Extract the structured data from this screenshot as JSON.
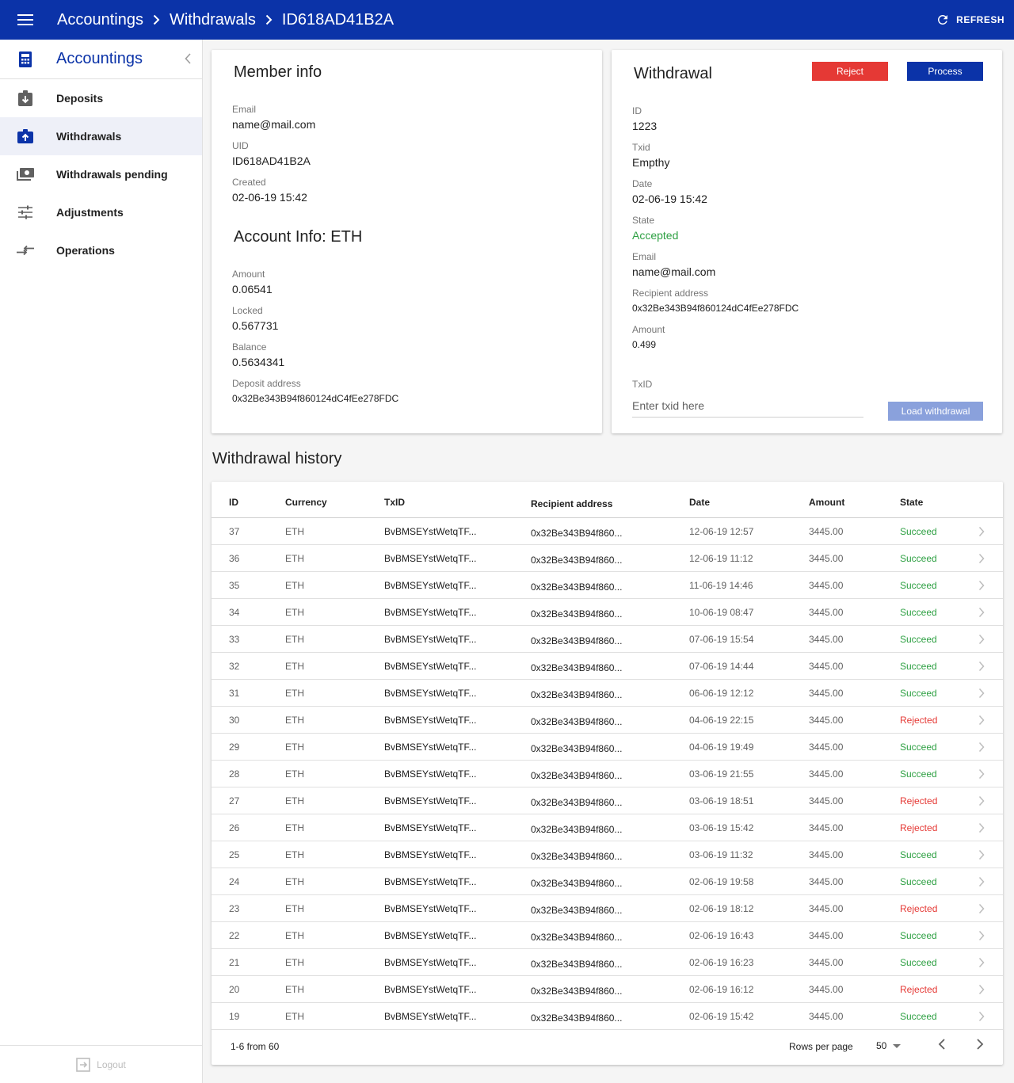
{
  "header": {
    "breadcrumb": [
      "Accountings",
      "Withdrawals",
      "ID618AD41B2A"
    ],
    "refresh_label": "REFRESH"
  },
  "sidebar": {
    "title": "Accountings",
    "items": [
      {
        "label": "Deposits",
        "icon": "deposit-icon"
      },
      {
        "label": "Withdrawals",
        "icon": "withdraw-icon"
      },
      {
        "label": "Withdrawals pending",
        "icon": "cash-icon"
      },
      {
        "label": "Adjustments",
        "icon": "tune-icon"
      },
      {
        "label": "Operations",
        "icon": "compare-arrows-icon"
      }
    ],
    "logout_label": "Logout"
  },
  "member_info": {
    "title": "Member info",
    "email_label": "Email",
    "email": "name@mail.com",
    "uid_label": "UID",
    "uid": "ID618AD41B2A",
    "created_label": "Created",
    "created": "02-06-19 15:42"
  },
  "account_info": {
    "title": "Account Info: ETH",
    "amount_label": "Amount",
    "amount": "0.06541",
    "locked_label": "Locked",
    "locked": "0.567731",
    "balance_label": "Balance",
    "balance": "0.5634341",
    "deposit_address_label": "Deposit address",
    "deposit_address": "0x32Be343B94f860124dC4fEe278FDC"
  },
  "withdrawal": {
    "title": "Withdrawal",
    "reject_label": "Reject",
    "process_label": "Process",
    "id_label": "ID",
    "id": "1223",
    "txid_label": "Txid",
    "txid": "Empthy",
    "date_label": "Date",
    "date": "02-06-19 15:42",
    "state_label": "State",
    "state": "Accepted",
    "email_label": "Email",
    "email": "name@mail.com",
    "recipient_label": "Recipient address",
    "recipient": "0x32Be343B94f860124dC4fEe278FDC",
    "amount_label": "Amount",
    "amount": "0.499",
    "txid_input_label": "TxID",
    "txid_input_placeholder": "Enter txid here",
    "load_label": "Load withdrawal"
  },
  "history": {
    "title": "Withdrawal history",
    "columns": [
      "ID",
      "Currency",
      "TxID",
      "Recipient address",
      "Date",
      "Amount",
      "State"
    ],
    "rows": [
      {
        "id": "37",
        "currency": "ETH",
        "txid": "BvBMSEYstWetqTF...",
        "address": "0x32Be343B94f860...",
        "date": "12-06-19 12:57",
        "amount": "3445.00",
        "state": "Succeed"
      },
      {
        "id": "36",
        "currency": "ETH",
        "txid": "BvBMSEYstWetqTF...",
        "address": "0x32Be343B94f860...",
        "date": "12-06-19 11:12",
        "amount": "3445.00",
        "state": "Succeed"
      },
      {
        "id": "35",
        "currency": "ETH",
        "txid": "BvBMSEYstWetqTF...",
        "address": "0x32Be343B94f860...",
        "date": "11-06-19 14:46",
        "amount": "3445.00",
        "state": "Succeed"
      },
      {
        "id": "34",
        "currency": "ETH",
        "txid": "BvBMSEYstWetqTF...",
        "address": "0x32Be343B94f860...",
        "date": "10-06-19 08:47",
        "amount": "3445.00",
        "state": "Succeed"
      },
      {
        "id": "33",
        "currency": "ETH",
        "txid": "BvBMSEYstWetqTF...",
        "address": "0x32Be343B94f860...",
        "date": "07-06-19 15:54",
        "amount": "3445.00",
        "state": "Succeed"
      },
      {
        "id": "32",
        "currency": "ETH",
        "txid": "BvBMSEYstWetqTF...",
        "address": "0x32Be343B94f860...",
        "date": "07-06-19 14:44",
        "amount": "3445.00",
        "state": "Succeed"
      },
      {
        "id": "31",
        "currency": "ETH",
        "txid": "BvBMSEYstWetqTF...",
        "address": "0x32Be343B94f860...",
        "date": "06-06-19 12:12",
        "amount": "3445.00",
        "state": "Succeed"
      },
      {
        "id": "30",
        "currency": "ETH",
        "txid": "BvBMSEYstWetqTF...",
        "address": "0x32Be343B94f860...",
        "date": "04-06-19 22:15",
        "amount": "3445.00",
        "state": "Rejected"
      },
      {
        "id": "29",
        "currency": "ETH",
        "txid": "BvBMSEYstWetqTF...",
        "address": "0x32Be343B94f860...",
        "date": "04-06-19 19:49",
        "amount": "3445.00",
        "state": "Succeed"
      },
      {
        "id": "28",
        "currency": "ETH",
        "txid": "BvBMSEYstWetqTF...",
        "address": "0x32Be343B94f860...",
        "date": "03-06-19 21:55",
        "amount": "3445.00",
        "state": "Succeed"
      },
      {
        "id": "27",
        "currency": "ETH",
        "txid": "BvBMSEYstWetqTF...",
        "address": "0x32Be343B94f860...",
        "date": "03-06-19 18:51",
        "amount": "3445.00",
        "state": "Rejected"
      },
      {
        "id": "26",
        "currency": "ETH",
        "txid": "BvBMSEYstWetqTF...",
        "address": "0x32Be343B94f860...",
        "date": "03-06-19 15:42",
        "amount": "3445.00",
        "state": "Rejected"
      },
      {
        "id": "25",
        "currency": "ETH",
        "txid": "BvBMSEYstWetqTF...",
        "address": "0x32Be343B94f860...",
        "date": "03-06-19 11:32",
        "amount": "3445.00",
        "state": "Succeed"
      },
      {
        "id": "24",
        "currency": "ETH",
        "txid": "BvBMSEYstWetqTF...",
        "address": "0x32Be343B94f860...",
        "date": "02-06-19 19:58",
        "amount": "3445.00",
        "state": "Succeed"
      },
      {
        "id": "23",
        "currency": "ETH",
        "txid": "BvBMSEYstWetqTF...",
        "address": "0x32Be343B94f860...",
        "date": "02-06-19 18:12",
        "amount": "3445.00",
        "state": "Rejected"
      },
      {
        "id": "22",
        "currency": "ETH",
        "txid": "BvBMSEYstWetqTF...",
        "address": "0x32Be343B94f860...",
        "date": "02-06-19 16:43",
        "amount": "3445.00",
        "state": "Succeed"
      },
      {
        "id": "21",
        "currency": "ETH",
        "txid": "BvBMSEYstWetqTF...",
        "address": "0x32Be343B94f860...",
        "date": "02-06-19 16:23",
        "amount": "3445.00",
        "state": "Succeed"
      },
      {
        "id": "20",
        "currency": "ETH",
        "txid": "BvBMSEYstWetqTF...",
        "address": "0x32Be343B94f860...",
        "date": "02-06-19 16:12",
        "amount": "3445.00",
        "state": "Rejected"
      },
      {
        "id": "19",
        "currency": "ETH",
        "txid": "BvBMSEYstWetqTF...",
        "address": "0x32Be343B94f860...",
        "date": "02-06-19 15:42",
        "amount": "3445.00",
        "state": "Succeed"
      }
    ],
    "footer": {
      "range": "1-6 from 60",
      "rows_per_page_label": "Rows per page",
      "rows_per_page": "50"
    }
  },
  "colors": {
    "primary": "#0b33a8",
    "reject": "#e53935",
    "success": "#2ea043",
    "load_button": "#8aa1dc"
  }
}
